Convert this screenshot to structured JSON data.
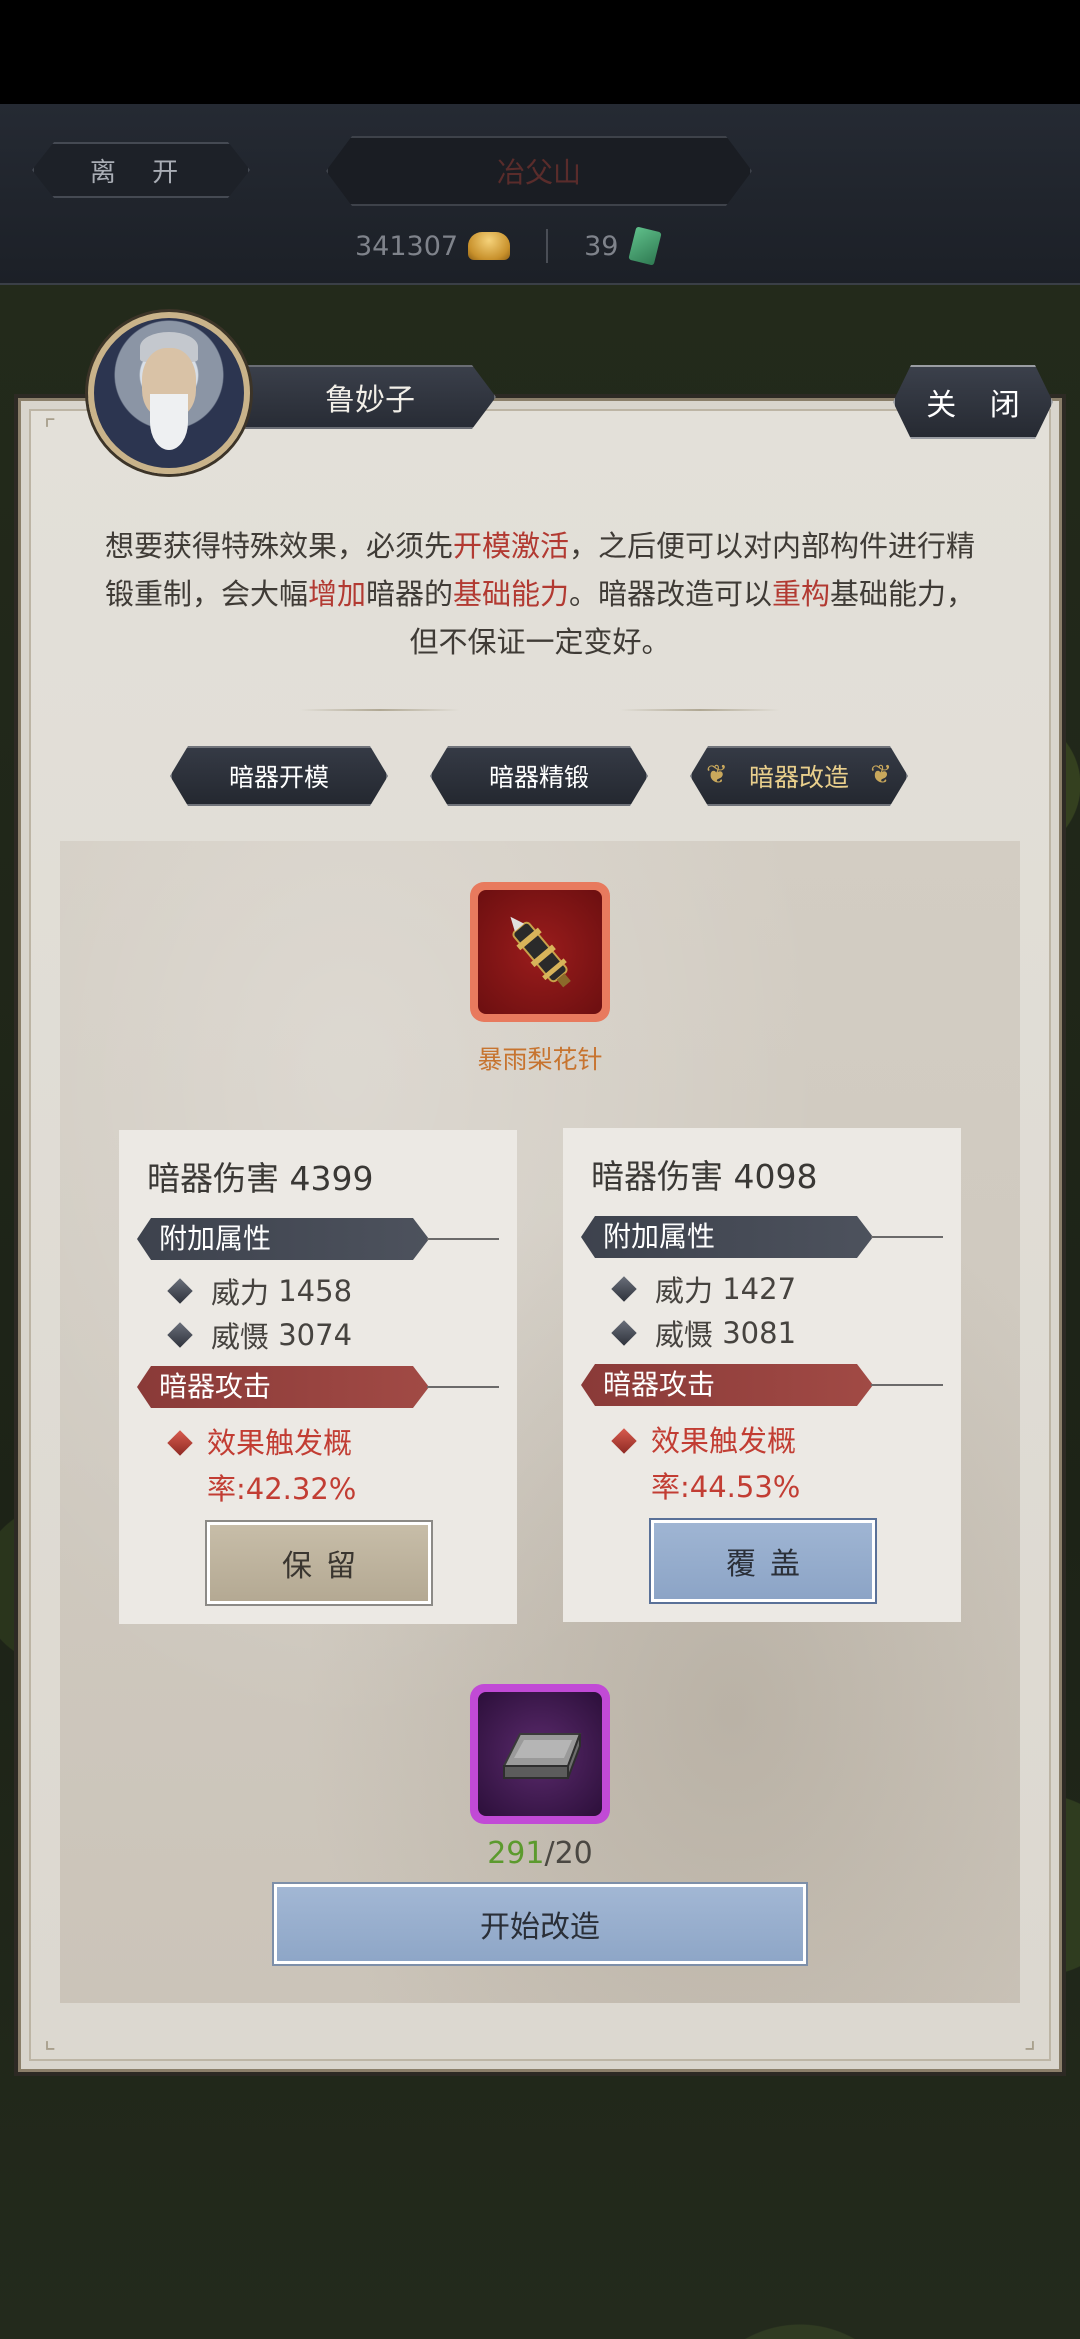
{
  "topbar": {
    "leave_label": "离 开",
    "location_name": "冶父山",
    "gold_amount": "341307",
    "jade_amount": "39"
  },
  "panel": {
    "npc_name": "鲁妙子",
    "close_label": "关 闭",
    "description": {
      "segments": [
        {
          "text": "想要获得特殊效果，必须先",
          "highlight": false
        },
        {
          "text": "开模激活",
          "highlight": true
        },
        {
          "text": "，之后便可以对内部构件进行精锻重制，会大幅",
          "highlight": false
        },
        {
          "text": "增加",
          "highlight": true
        },
        {
          "text": "暗器的",
          "highlight": false
        },
        {
          "text": "基础能力",
          "highlight": true
        },
        {
          "text": "。暗器改造可以",
          "highlight": false
        },
        {
          "text": "重构",
          "highlight": true
        },
        {
          "text": "基础能力，但不保证一定变好。",
          "highlight": false
        }
      ]
    },
    "tabs": [
      {
        "label": "暗器开模",
        "active": false
      },
      {
        "label": "暗器精锻",
        "active": false
      },
      {
        "label": "暗器改造",
        "active": true
      }
    ],
    "weapon": {
      "name": "暴雨梨花针",
      "icon": "needle-case-icon"
    },
    "current": {
      "damage_label": "暗器伤害",
      "damage_value": "4399",
      "bonus_section": "附加属性",
      "attrs": [
        {
          "name": "威力",
          "value": "1458"
        },
        {
          "name": "威慑",
          "value": "3074"
        }
      ],
      "attack_section": "暗器攻击",
      "effect": "效果触发概率:42.32%",
      "button_label": "保留"
    },
    "new": {
      "damage_label": "暗器伤害",
      "damage_value": "4098",
      "bonus_section": "附加属性",
      "attrs": [
        {
          "name": "威力",
          "value": "1427"
        },
        {
          "name": "威慑",
          "value": "3081"
        }
      ],
      "attack_section": "暗器攻击",
      "effect": "效果触发概率:44.53%",
      "button_label": "覆盖"
    },
    "material": {
      "icon": "iron-ingot-icon",
      "have": "291",
      "need": "/20"
    },
    "start_label": "开始改造"
  },
  "colors": {
    "highlight_red": "#b23a32",
    "weapon_name": "#c7742f",
    "material_have": "#5c9a2e",
    "rarity_red": "#e87a5e",
    "rarity_purple": "#c14ad6"
  }
}
